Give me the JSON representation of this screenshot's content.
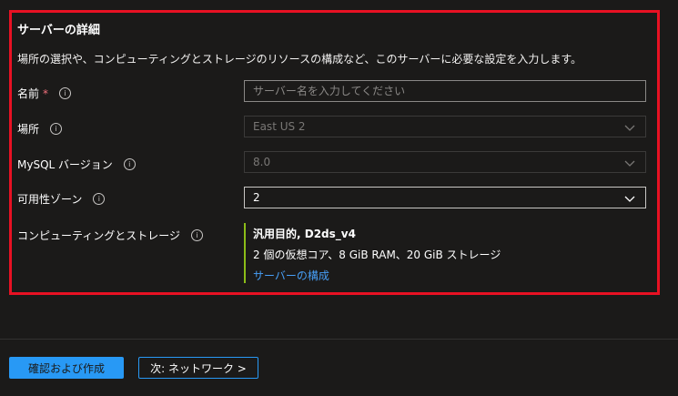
{
  "section": {
    "title": "サーバーの詳細",
    "description": "場所の選択や、コンピューティングとストレージのリソースの構成など、このサーバーに必要な設定を入力します。"
  },
  "fields": {
    "name": {
      "label": "名前",
      "required_mark": "*",
      "placeholder": "サーバー名を入力してください",
      "value": ""
    },
    "location": {
      "label": "場所",
      "value": "East US 2",
      "disabled": true
    },
    "mysql_version": {
      "label": "MySQL バージョン",
      "value": "8.0",
      "disabled": true
    },
    "availability_zone": {
      "label": "可用性ゾーン",
      "value": "2",
      "disabled": false
    },
    "compute_storage": {
      "label": "コンピューティングとストレージ",
      "tier": "汎用目的, D2ds_v4",
      "spec": "2 個の仮想コア、8 GiB RAM、20 GiB ストレージ",
      "configure_link": "サーバーの構成"
    }
  },
  "icons": {
    "info": "ⓘ",
    "chevron": "chevron-down-icon"
  },
  "footer": {
    "review_create_label": "確認および作成",
    "next_label": "次: ネットワーク >"
  },
  "colors": {
    "background": "#1b1a19",
    "highlight_border": "#e81123",
    "accent": "#2899f5",
    "link": "#479ef5",
    "compute_bar": "#8cbd18",
    "required": "#f1707b"
  }
}
